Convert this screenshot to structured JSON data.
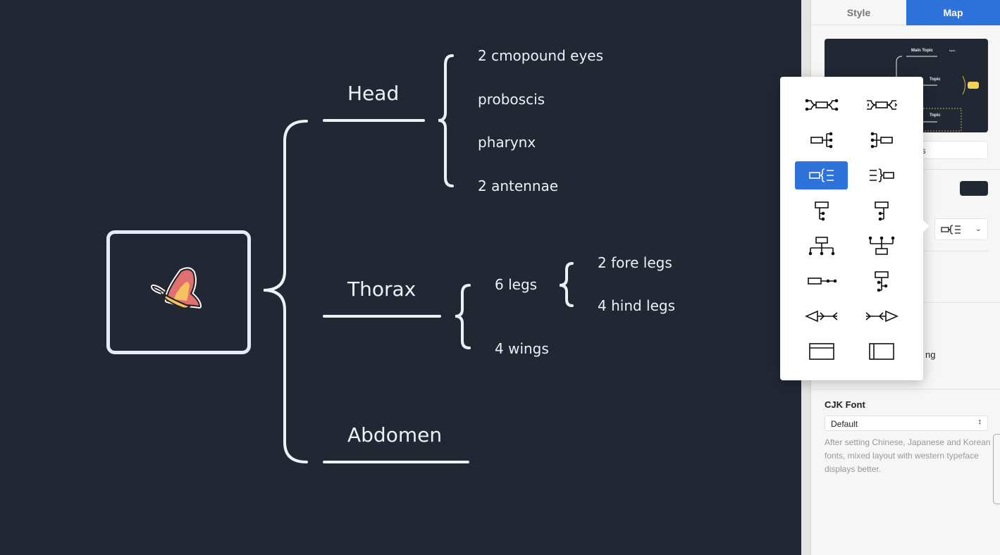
{
  "mindmap": {
    "central_icon": "butterfly-icon",
    "topics": [
      {
        "label": "Head",
        "children": [
          "2 cmopound eyes",
          "proboscis",
          "pharynx",
          "2 antennae"
        ]
      },
      {
        "label": "Thorax",
        "children": [
          "6 legs",
          "4 wings"
        ],
        "grandchildren": [
          "2 fore legs",
          "4 hind legs"
        ]
      },
      {
        "label": "Abdomen"
      }
    ]
  },
  "panel": {
    "tabs": [
      {
        "label": "Style",
        "active": false
      },
      {
        "label": "Map",
        "active": true
      }
    ],
    "preview": {
      "main_topic": "Main Topic",
      "topic2": "Topic",
      "topic3": "Topic",
      "sub": "topic"
    },
    "hidden_fragment_1": "es",
    "hidden_fragment_2": "ng",
    "structure_select_icon": "brace-right-structure-icon",
    "cjk_font": {
      "label": "CJK Font",
      "value": "Default",
      "help": "After setting Chinese, Japanese and Korean fonts, mixed layout with western typeface displays better."
    },
    "accent": "#2e73dc"
  },
  "structure_popover": {
    "items": [
      "mind-map",
      "mind-map-clockwise",
      "logic-right",
      "logic-left",
      "brace-right",
      "brace-left",
      "org-chart-down",
      "org-chart-down-alt",
      "tree-down",
      "tree-up",
      "timeline-horizontal",
      "tree-table",
      "fishbone-left",
      "fishbone-right",
      "matrix-row",
      "matrix-column"
    ],
    "selected": "brace-right"
  }
}
